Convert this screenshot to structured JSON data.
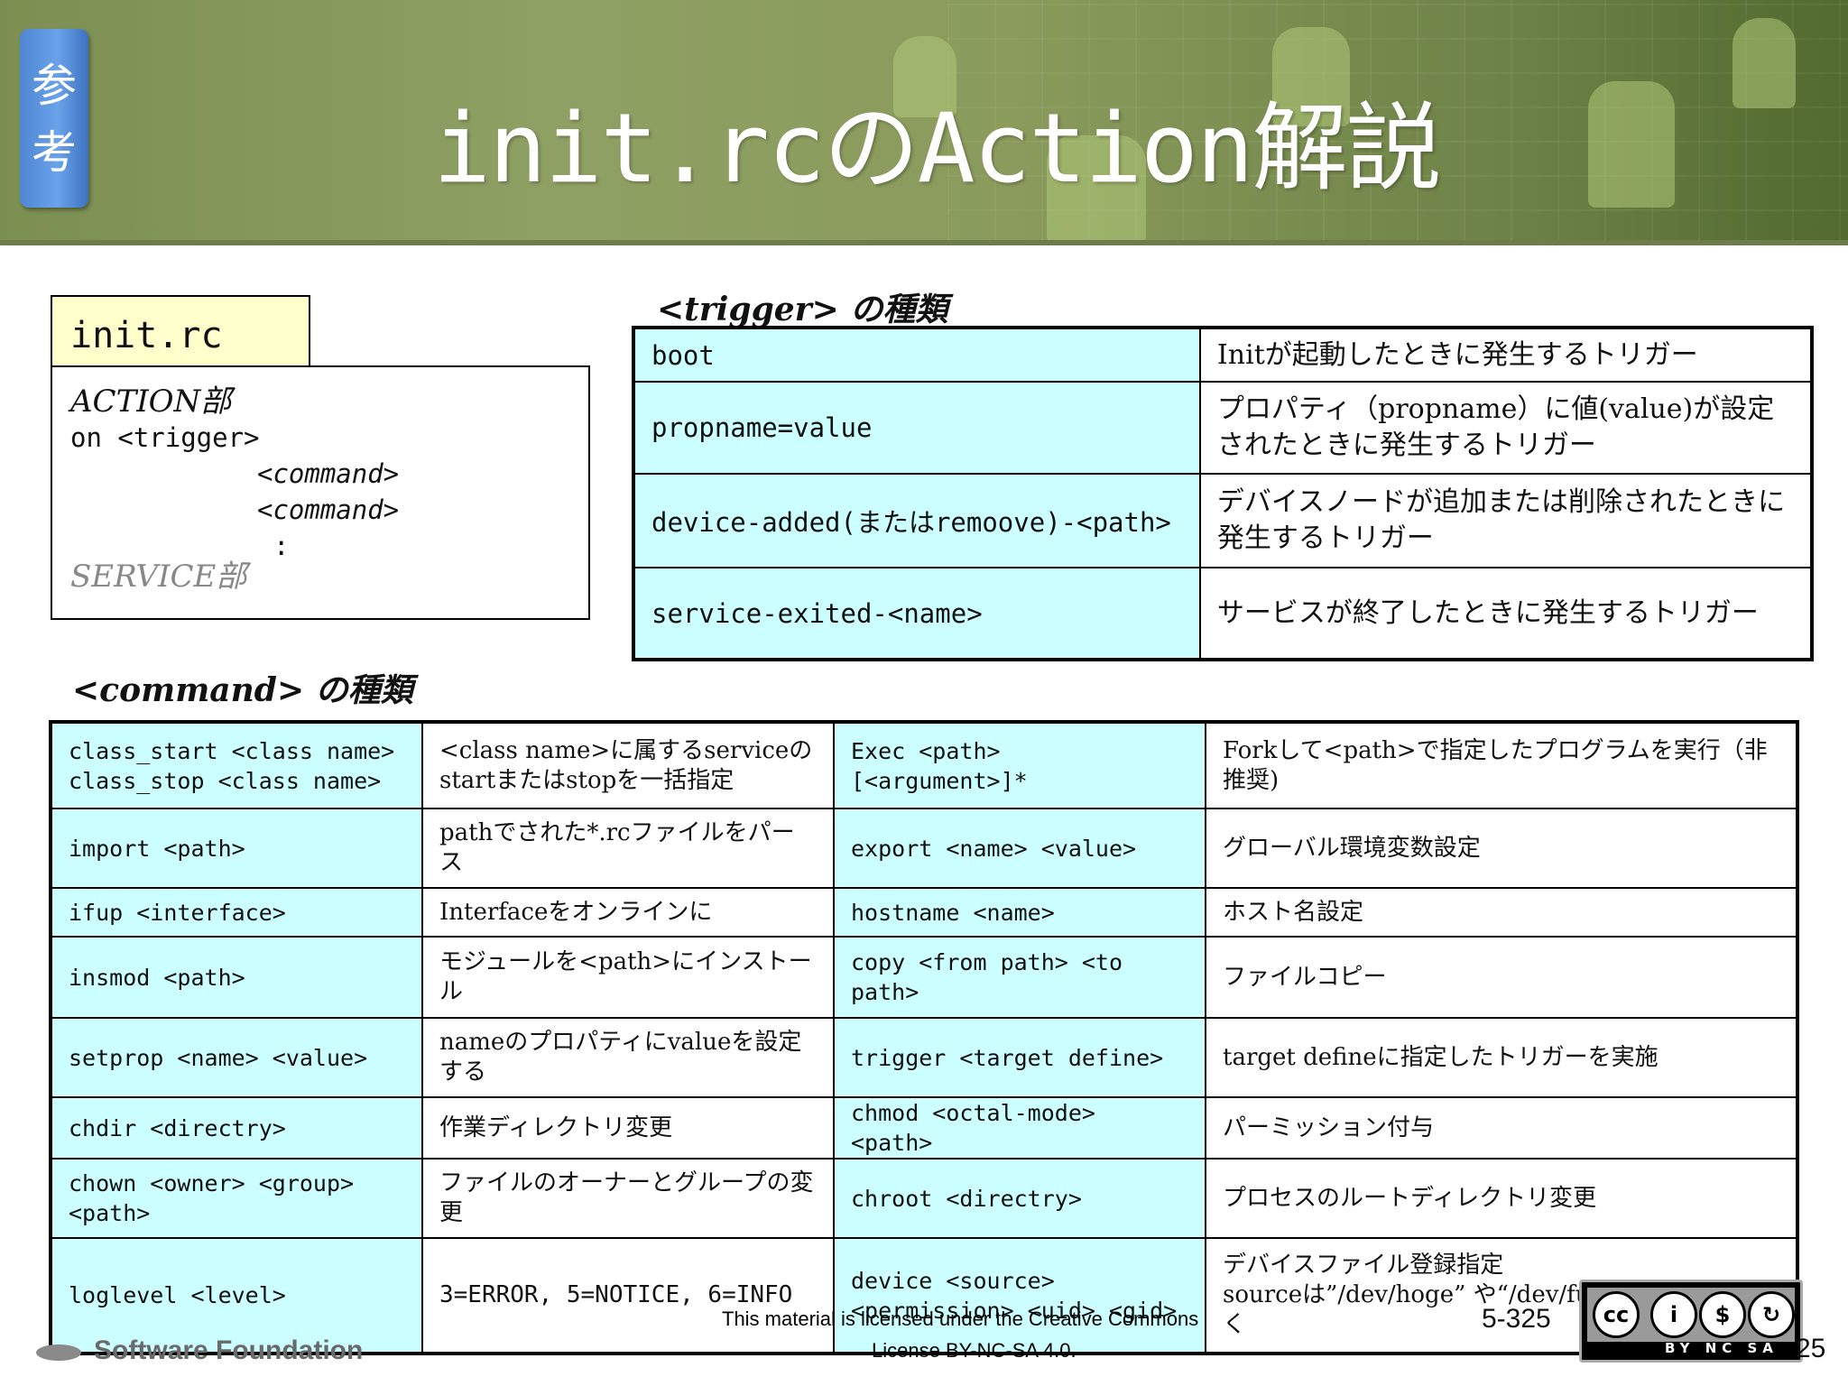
{
  "header": {
    "badge": "参考",
    "title": "init.rcのAction解説"
  },
  "init_rc_box": {
    "tab": "init.rc",
    "action_heading": "ACTION部",
    "on_line": "on <trigger>",
    "command1": "<command>",
    "command2": "<command>",
    "ellipsis": ":",
    "service_heading": "SERVICE部"
  },
  "trigger_table": {
    "caption": "<trigger> の種類",
    "rows": [
      {
        "key": "boot",
        "desc": "Initが起動したときに発生するトリガー"
      },
      {
        "key": "propname=value",
        "desc": "プロパティ（propname）に値(value)が設定されたときに発生するトリガー"
      },
      {
        "key": "device-added(またはremoove)-<path>",
        "desc": "デバイスノードが追加または削除されたときに発生するトリガー"
      },
      {
        "key": "service-exited-<name>",
        "desc": "サービスが終了したときに発生するトリガー"
      }
    ]
  },
  "command_table": {
    "caption": "<command> の種類",
    "rows": [
      {
        "k1": "class_start <class name>",
        "k1b": "class_stop <class name>",
        "d1": "<class name>に属するserviceのstartまたはstopを一括指定",
        "k2": "Exec <path> [<argument>]*",
        "d2": "Forkして<path>で指定したプログラムを実行（非推奨)"
      },
      {
        "k1": "import <path>",
        "k1b": "",
        "d1": "pathでされた*.rcファイルをパース",
        "k2": "export <name> <value>",
        "d2": "グローバル環境変数設定"
      },
      {
        "k1": "ifup <interface>",
        "k1b": "",
        "d1": "Interfaceをオンラインに",
        "k2": "hostname <name>",
        "d2": "ホスト名設定"
      },
      {
        "k1": "insmod <path>",
        "k1b": "",
        "d1": "モジュールを<path>にインストール",
        "k2": "copy <from path> <to path>",
        "d2": "ファイルコピー"
      },
      {
        "k1": "setprop <name> <value>",
        "k1b": "",
        "d1": "nameのプロパティにvalueを設定する",
        "k2": "trigger <target define>",
        "d2": "target defineに指定したトリガーを実施"
      },
      {
        "k1": "chdir <directry>",
        "k1b": "",
        "d1": "作業ディレクトリ変更",
        "k2": "chmod <octal-mode> <path>",
        "d2": "パーミッション付与"
      },
      {
        "k1": "chown <owner> <group> <path>",
        "k1b": "",
        "d1": "ファイルのオーナーとグループの変更",
        "k2": "chroot <directry>",
        "d2": "プロセスのルートディレクトリ変更"
      },
      {
        "k1": "loglevel <level>",
        "k1b": "",
        "d1": "3=ERROR, 5=NOTICE, 6=INFO",
        "k2": "device <source> <permission> <uid> <gid>",
        "d2": "デバイスファイル登録指定",
        "d2b": "sourceは”/dev/hoge” や“/dev/fugah”のように書く"
      }
    ]
  },
  "footer": {
    "license_line1": "This material is licensed under the Creative Commons",
    "license_line2": "License BY-NC-SA 4.0.",
    "page_number": "5-325",
    "page_number_corner": "25",
    "logo_text": "Software Foundation",
    "cc_label": "BY NC SA"
  }
}
